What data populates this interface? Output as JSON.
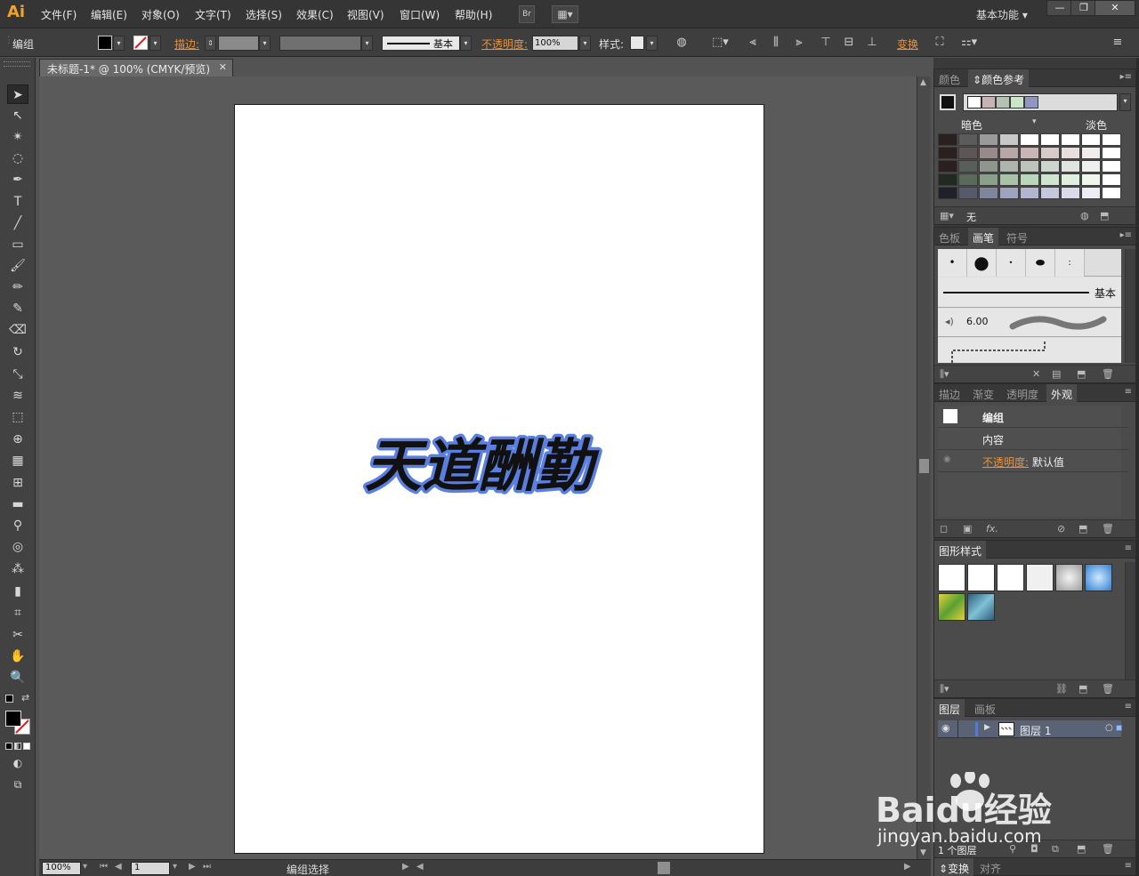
{
  "app": {
    "logo": "Ai",
    "menus": [
      "文件(F)",
      "编辑(E)",
      "对象(O)",
      "文字(T)",
      "选择(S)",
      "效果(C)",
      "视图(V)",
      "窗口(W)",
      "帮助(H)"
    ],
    "bridge_label": "Br",
    "workspace": "基本功能",
    "window_controls": [
      "—",
      "❐",
      "✕"
    ]
  },
  "control_bar": {
    "selection_label": "编组",
    "stroke_label": "描边:",
    "brush_label": "基本",
    "opacity_label": "不透明度:",
    "opacity_value": "100%",
    "style_label": "样式:",
    "transform_label": "变换"
  },
  "tools": [
    {
      "name": "selection-tool",
      "glyph": "➤"
    },
    {
      "name": "direct-selection-tool",
      "glyph": "↖"
    },
    {
      "name": "magic-wand-tool",
      "glyph": "✴"
    },
    {
      "name": "lasso-tool",
      "glyph": "◌"
    },
    {
      "name": "pen-tool",
      "glyph": "✒"
    },
    {
      "name": "type-tool",
      "glyph": "T"
    },
    {
      "name": "line-tool",
      "glyph": "╱"
    },
    {
      "name": "rectangle-tool",
      "glyph": "▭"
    },
    {
      "name": "paintbrush-tool",
      "glyph": "🖌"
    },
    {
      "name": "pencil-tool",
      "glyph": "✏"
    },
    {
      "name": "blob-brush-tool",
      "glyph": "✎"
    },
    {
      "name": "eraser-tool",
      "glyph": "⌫"
    },
    {
      "name": "rotate-tool",
      "glyph": "↻"
    },
    {
      "name": "scale-tool",
      "glyph": "⤡"
    },
    {
      "name": "warp-tool",
      "glyph": "≋"
    },
    {
      "name": "free-transform-tool",
      "glyph": "⬚"
    },
    {
      "name": "shape-builder-tool",
      "glyph": "⊕"
    },
    {
      "name": "perspective-grid-tool",
      "glyph": "▦"
    },
    {
      "name": "mesh-tool",
      "glyph": "⊞"
    },
    {
      "name": "gradient-tool",
      "glyph": "▬"
    },
    {
      "name": "eyedropper-tool",
      "glyph": "⚲"
    },
    {
      "name": "blend-tool",
      "glyph": "◎"
    },
    {
      "name": "symbol-sprayer-tool",
      "glyph": "⁂"
    },
    {
      "name": "column-graph-tool",
      "glyph": "▮"
    },
    {
      "name": "artboard-tool",
      "glyph": "⌗"
    },
    {
      "name": "slice-tool",
      "glyph": "✂"
    },
    {
      "name": "hand-tool",
      "glyph": "✋"
    },
    {
      "name": "zoom-tool",
      "glyph": "🔍"
    }
  ],
  "document": {
    "tab_title": "未标题-1* @ 100% (CMYK/预览)",
    "artwork_text": "天道酬勤",
    "artwork_color": "#5b7fe0",
    "zoom": "100%",
    "page": "1",
    "status": "编组选择"
  },
  "color_guide": {
    "tabs": [
      "颜色",
      "颜色参考"
    ],
    "dark_label": "暗色",
    "light_label": "淡色",
    "harmony_swatches": [
      "#ffffff",
      "#c7b3b3",
      "#b3c2b3",
      "#c9e6c9",
      "#8f96c2"
    ],
    "grid_rows": [
      [
        "#2a2020",
        "#5b5b5b",
        "#9a9a9a",
        "#c8c8c8",
        "#ffffff",
        "#ffffff",
        "#ffffff",
        "#ffffff",
        "#ffffff"
      ],
      [
        "#2a2020",
        "#5e5656",
        "#988a8a",
        "#b9a6a6",
        "#c9b5b5",
        "#d9caca",
        "#e8dede",
        "#f2ecec",
        "#ffffff"
      ],
      [
        "#2a2020",
        "#5a5e5a",
        "#8e968e",
        "#adb5ad",
        "#bcc4bc",
        "#ced4ce",
        "#e0e4e0",
        "#eef0ee",
        "#ffffff"
      ],
      [
        "#202a20",
        "#5a6a5a",
        "#8aa08a",
        "#a9c3a9",
        "#bcd6bc",
        "#cfe4cf",
        "#e0efe0",
        "#eef6ee",
        "#ffffff"
      ],
      [
        "#20202a",
        "#565a6a",
        "#7f849f",
        "#9ea3c0",
        "#b1b5d0",
        "#c5c8dd",
        "#d9dbea",
        "#ebecf4",
        "#ffffff"
      ]
    ],
    "footer_label": "无"
  },
  "brushes": {
    "tabs": [
      "色板",
      "画笔",
      "符号"
    ],
    "basic_label": "基本",
    "size_value": "6.00"
  },
  "appearance": {
    "tabs": [
      "描边",
      "渐变",
      "透明度",
      "外观"
    ],
    "title": "编组",
    "content_label": "内容",
    "opacity_label": "不透明度:",
    "opacity_value": "默认值"
  },
  "graphic_styles": {
    "title": "图形样式",
    "cells": [
      "#ffffff",
      "#ffffff",
      "#ffffff",
      "#f0f0f0",
      "#cfcfcf",
      "#5aa2e0",
      "#9ac43a",
      "#4f8fa8"
    ]
  },
  "layers": {
    "tabs": [
      "图层",
      "画板"
    ],
    "layer_name": "图层 1",
    "layer_count": "1 个图层",
    "layer_color": "#4f7bd9"
  },
  "bottom_panel": {
    "tabs": [
      "变换",
      "对齐"
    ]
  },
  "watermark": {
    "brand": "Baidu经验",
    "url": "jingyan.baidu.com"
  }
}
